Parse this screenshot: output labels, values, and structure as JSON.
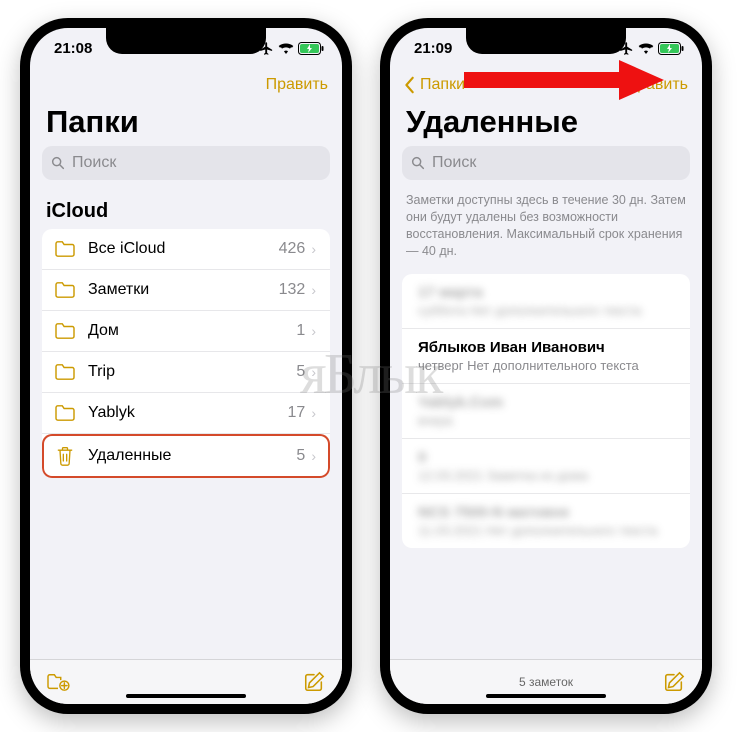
{
  "colors": {
    "accent": "#cc9a00",
    "highlight": "#d44a2a",
    "background": "#f2f2f7"
  },
  "watermark": "яБлык",
  "left": {
    "status_time": "21:08",
    "nav": {
      "edit": "Править"
    },
    "title": "Папки",
    "search_placeholder": "Поиск",
    "section": "iCloud",
    "folders": [
      {
        "label": "Все iCloud",
        "count": "426",
        "icon": "folder"
      },
      {
        "label": "Заметки",
        "count": "132",
        "icon": "folder"
      },
      {
        "label": "Дом",
        "count": "1",
        "icon": "folder"
      },
      {
        "label": "Trip",
        "count": "5",
        "icon": "folder"
      },
      {
        "label": "Yablyk",
        "count": "17",
        "icon": "folder"
      },
      {
        "label": "Удаленные",
        "count": "5",
        "icon": "trash",
        "highlighted": true
      }
    ]
  },
  "right": {
    "status_time": "21:09",
    "nav": {
      "back": "Папки",
      "edit": "Править"
    },
    "title": "Удаленные",
    "search_placeholder": "Поиск",
    "info": "Заметки доступны здесь в течение 30 дн. Затем они будут удалены без возможности восстановления. Максимальный срок хранения — 40 дн.",
    "notes": [
      {
        "title": "17 марта",
        "sub": "суббота Нет дополнительного текста",
        "blurred": true
      },
      {
        "title": "Яблыков Иван Иванович",
        "sub": "четверг  Нет дополнительного текста",
        "blurred": false
      },
      {
        "title": "Yablyk.Com",
        "sub": "вчера",
        "blurred": true
      },
      {
        "title": "0",
        "sub": "12.03.2021 Заметка из дома",
        "blurred": true
      },
      {
        "title": "NCS 7500-N матовое",
        "sub": "11.03.2021 Нет дополнительного текста",
        "blurred": true
      }
    ],
    "footer": "5 заметок"
  }
}
